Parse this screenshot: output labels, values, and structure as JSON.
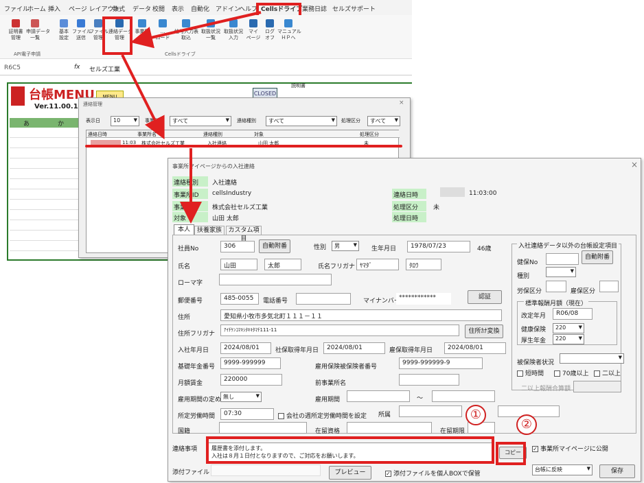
{
  "menu": [
    "ファイル",
    "ホーム",
    "挿入",
    "ページ レイアウト",
    "数式",
    "データ",
    "校閲",
    "表示",
    "自動化",
    "アドイン",
    "ヘルプ",
    "Cellsドライブ",
    "業務日誌",
    "セルズサポート"
  ],
  "ribbon_left": [
    {
      "label": "証明書\n管理"
    },
    {
      "label": "申請データ\n一覧"
    }
  ],
  "ribbon_left_group": "API電子申請",
  "ribbon_main": [
    {
      "label": "基本\n設定"
    },
    {
      "label": "ファイル\n送信"
    },
    {
      "label": "ファイル\n管理"
    },
    {
      "label": "連絡データ\n管理"
    },
    {
      "label": "事業所\n..."
    },
    {
      "label": "...\nロード"
    },
    {
      "label": "給与入力表\n取込"
    },
    {
      "label": "取扱状況\n一覧"
    },
    {
      "label": "取扱状況\n入力"
    },
    {
      "label": "マイ\nページ"
    },
    {
      "label": "ログ\nオフ"
    },
    {
      "label": "マニュアル\nＨＰへ"
    }
  ],
  "ribbon_main_group": "Cellsドライブ",
  "formula": {
    "cell_ref": "R6C5",
    "fx": "fx",
    "value": "セルズ工業"
  },
  "sheet": {
    "logo": "台帳MENU",
    "version": "Ver.11.00.16",
    "col_a": "あ",
    "col_ka": "か",
    "menu_btn": "MENU",
    "closed": "CLOSED",
    "setsumei": "説明書"
  },
  "contact_mgmt": {
    "title": "連絡管理",
    "close": "×",
    "filter": {
      "date_label": "表示日",
      "date_value": "10",
      "kind_label": "事業所名",
      "kind_value": "すべて",
      "type_label": "連絡種別",
      "type_value": "すべて",
      "status_label": "処理区分",
      "status_value": "すべて"
    },
    "columns": [
      "連絡日時",
      "事業所名",
      "連絡種別",
      "対象",
      "処理区分"
    ],
    "row": {
      "time": "11:03",
      "company": "株式会社セルズ工業",
      "type": "入社連絡",
      "target": "山田 太郎",
      "status": "未"
    }
  },
  "detail": {
    "title": "事業所マイページからの入社連絡",
    "close": "×",
    "top": {
      "kind_label": "連絡種別",
      "kind_value": "入社連絡",
      "office_id_label": "事業所ID",
      "office_id_value": "cellsIndustry",
      "office_label": "事業所名",
      "office_value": "株式会社セルズ工業",
      "target_label": "対象",
      "target_value": "山田 太郎",
      "date_label": "連絡日時",
      "date_value": "11:03:00",
      "status_label": "処理区分",
      "status_value": "未",
      "proc_date_label": "処理日時"
    },
    "tabs": [
      "本人",
      "扶養家族",
      "カスタム項目"
    ],
    "form": {
      "emp_no_label": "社員No",
      "emp_no": "306",
      "auto_no": "自動附番",
      "sex_label": "性別",
      "sex": "男",
      "birth_label": "生年月日",
      "birth": "1978/07/23",
      "age": "46歳",
      "name_label": "氏名",
      "last": "山田",
      "first": "太郎",
      "kana_label": "氏名フリガナ",
      "last_kana": "ﾔﾏﾀﾞ",
      "first_kana": "ﾀﾛｳ",
      "roman_label": "ローマ字",
      "zip_label": "郵便番号",
      "zip": "485-0055",
      "tel_label": "電話番号",
      "mynum_label": "マイナンバー",
      "mynum": "************",
      "auth": "認証",
      "addr_label": "住所",
      "addr": "愛知県小牧市多気北町１１１－１１",
      "addr_kana_label": "住所フリガナ",
      "addr_kana": "ｱｲﾁｹﾝｺﾏｷｼﾀｷｷﾀﾏﾁ111-11",
      "addr_conv": "住所ｶﾅ変換",
      "join_label": "入社年月日",
      "join": "2024/08/01",
      "si_label": "社保取得年月日",
      "si": "2024/08/01",
      "ei_label": "雇保取得年月日",
      "ei": "2024/08/01",
      "pension_label": "基礎年金番号",
      "pension": "9999-999999",
      "ei_no_label": "雇用保険被保険者番号",
      "ei_no": "9999-999999-9",
      "wage_label": "月額賃金",
      "wage": "220000",
      "prev_label": "前事業所名",
      "term_label": "雇用期間の定め",
      "term": "無し",
      "period_label": "雇用期間",
      "tilde": "～",
      "hours_label": "所定労働時間",
      "hours": "07:30",
      "weekly_label": "会社の週所定労働時間を設定",
      "dept_label": "所属",
      "nation_label": "国籍",
      "status_label": "在留資格",
      "limit_label": "在留期限"
    },
    "side": {
      "title": "入社連絡データ以外の台帳設定項目",
      "kenpo_label": "健保No",
      "auto_no": "自動附番",
      "kind_label": "種別",
      "rousai_label": "労保区分",
      "koho_label": "雇保区分",
      "std_title": "標準報酬月額（現在）",
      "rev_label": "改定年月",
      "rev": "R06/08",
      "kenko_label": "健康保険",
      "kenko": "220",
      "kosei_label": "厚生年金",
      "kosei": "220",
      "stat_label": "被保険者状況",
      "short": "短時間",
      "over70": "70歳以上",
      "multi": "二以上",
      "multi_sum": "二以上報酬合算額"
    },
    "notes_label": "連絡事項",
    "notes": [
      "履歴書を添付します。",
      "入社は８月１日付となりますので、ご対応をお願いします。"
    ],
    "copy": "コピー",
    "publish": "事業所マイページに公開",
    "attach_label": "添付ファイル",
    "preview": "プレビュー",
    "box": "添付ファイルを個人BOXで保管",
    "apply": "台帳に反映",
    "save": "保存"
  },
  "markers": [
    "①",
    "②"
  ]
}
